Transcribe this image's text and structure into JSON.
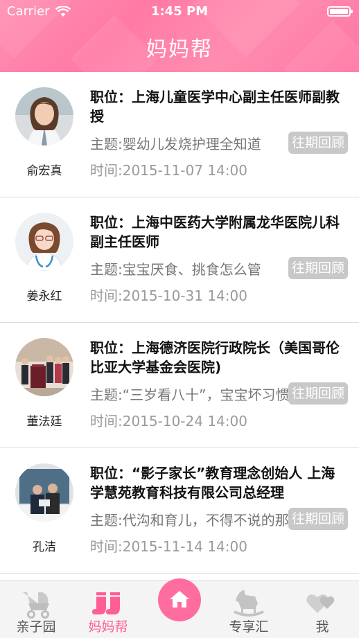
{
  "status_bar": {
    "carrier": "Carrier",
    "time": "1:45 PM"
  },
  "header": {
    "title": "妈妈帮"
  },
  "experts": [
    {
      "name": "俞宏真",
      "role": "职位：上海儿童医学中心副主任医师副教授",
      "topic": "主题:婴幼儿发烧护理全知道",
      "time": "时间:2015-11-07 14:00",
      "button": "往期回顾"
    },
    {
      "name": "姜永红",
      "role": "职位：上海中医药大学附属龙华医院儿科副主任医师",
      "topic": "主题:宝宝厌食、挑食怎么管",
      "time": "时间:2015-10-31 14:00",
      "button": "往期回顾"
    },
    {
      "name": "董法廷",
      "role": "职位：上海德济医院行政院长（美国哥伦比亚大学基金会医院)",
      "topic": "主题:“三岁看八十”，宝宝坏习惯早纠正",
      "time": "时间:2015-10-24 14:00",
      "button": "往期回顾"
    },
    {
      "name": "孔洁",
      "role": "职位：“影子家长”教育理念创始人 上海学慧苑教育科技有限公司总经理",
      "topic": "主题:代沟和育儿，不得不说的那些事",
      "time": "时间:2015-11-14 14:00",
      "button": "往期回顾"
    }
  ],
  "tabbar": {
    "tabs": [
      {
        "label": "亲子园",
        "icon": "stroller-icon"
      },
      {
        "label": "妈妈帮",
        "icon": "baby-booties-icon"
      },
      {
        "label": "",
        "icon": "home-icon"
      },
      {
        "label": "专享汇",
        "icon": "rocking-horse-icon"
      },
      {
        "label": "我",
        "icon": "hearts-icon"
      }
    ],
    "active_index": 1,
    "active_color": "#ff5d94",
    "home_button_color": "#ff6ca0"
  }
}
